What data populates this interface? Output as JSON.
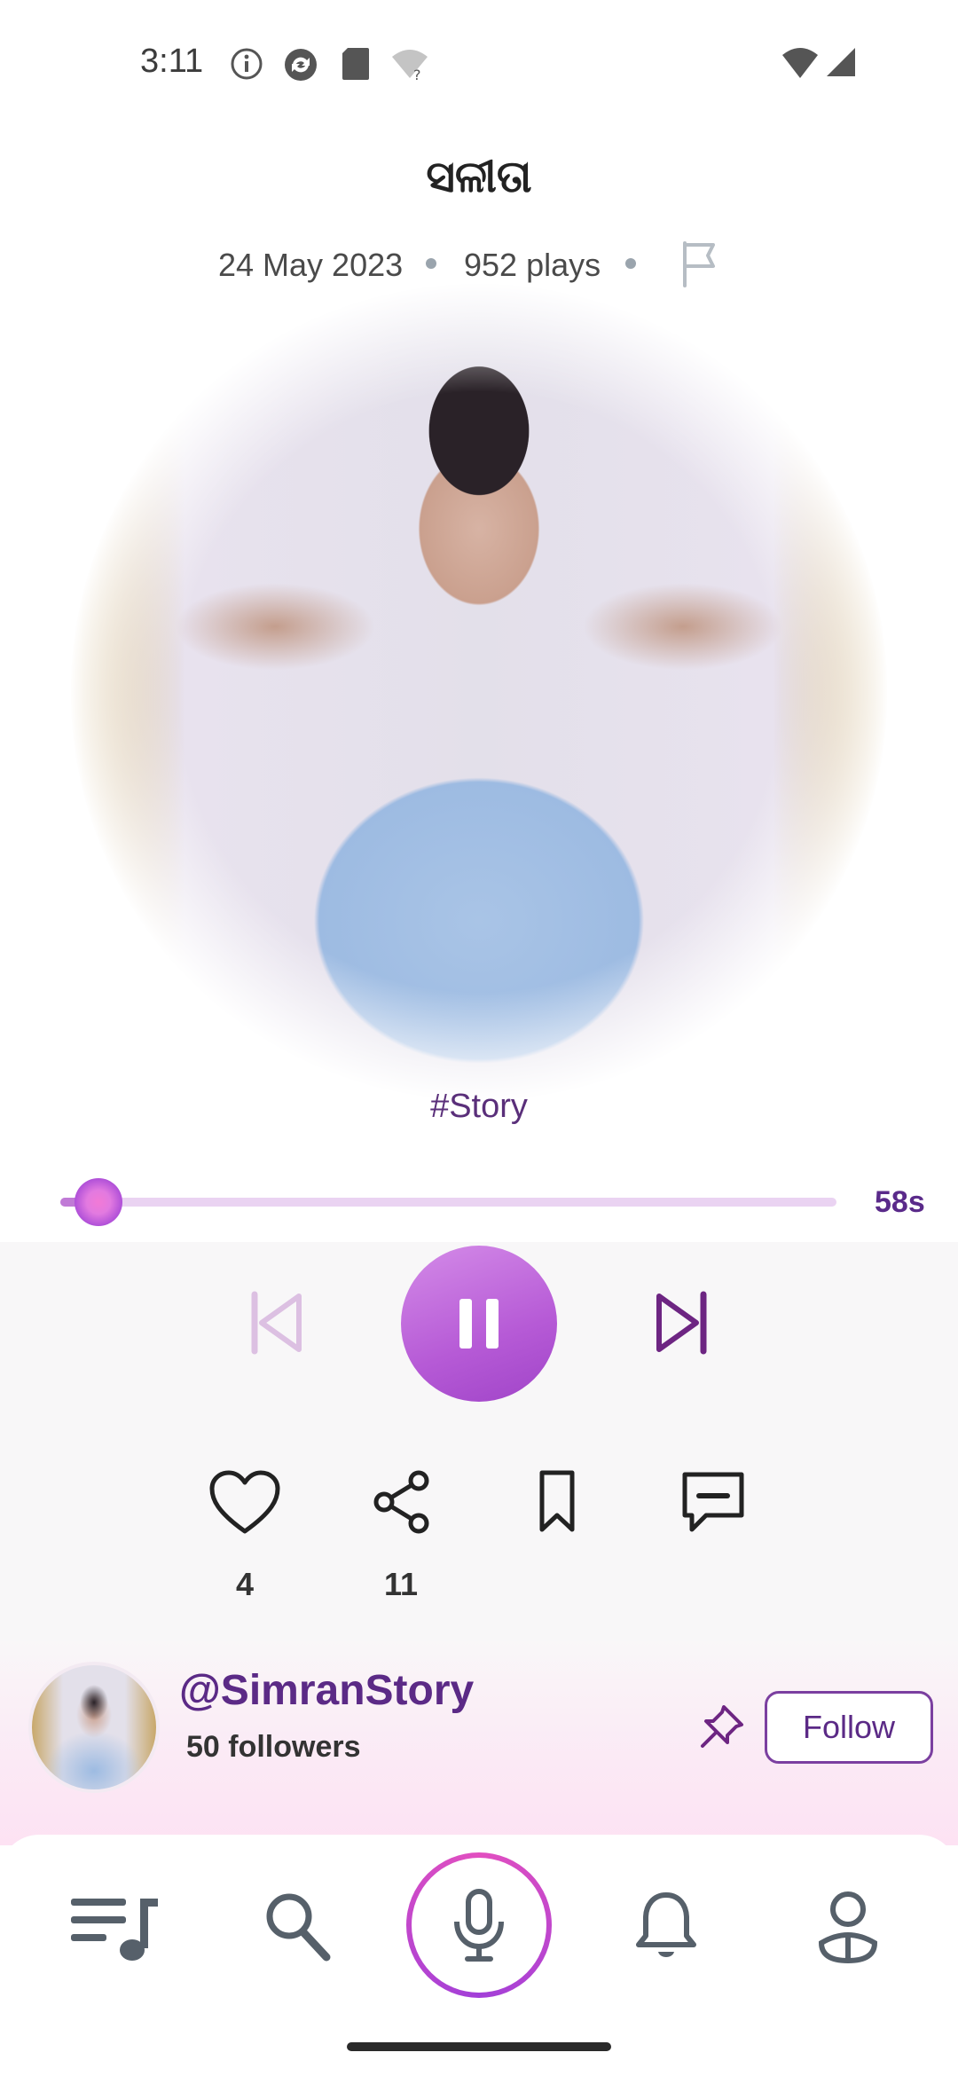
{
  "status_bar": {
    "time": "3:11",
    "icons": [
      "info-icon",
      "sync-icon",
      "sd-card-icon",
      "wifi-unknown-icon",
      "wifi-icon",
      "signal-icon"
    ]
  },
  "track": {
    "title": "ସଳୀତା",
    "date": "24 May 2023",
    "plays": "952 plays",
    "hashtag": "#Story"
  },
  "player": {
    "progress_fraction": 0.04,
    "time_remaining": "58s",
    "state": "playing"
  },
  "actions": {
    "likes": "4",
    "shares": "11"
  },
  "creator": {
    "handle": "@SimranStory",
    "followers": "50 followers",
    "follow_label": "Follow"
  },
  "nav": {
    "items": [
      "playlist-icon",
      "search-icon",
      "mic-icon",
      "bell-icon",
      "profile-icon"
    ]
  },
  "colors": {
    "accent": "#5b2a86",
    "play_button": "#b65ad6",
    "progress_track": "#ead3f2"
  }
}
